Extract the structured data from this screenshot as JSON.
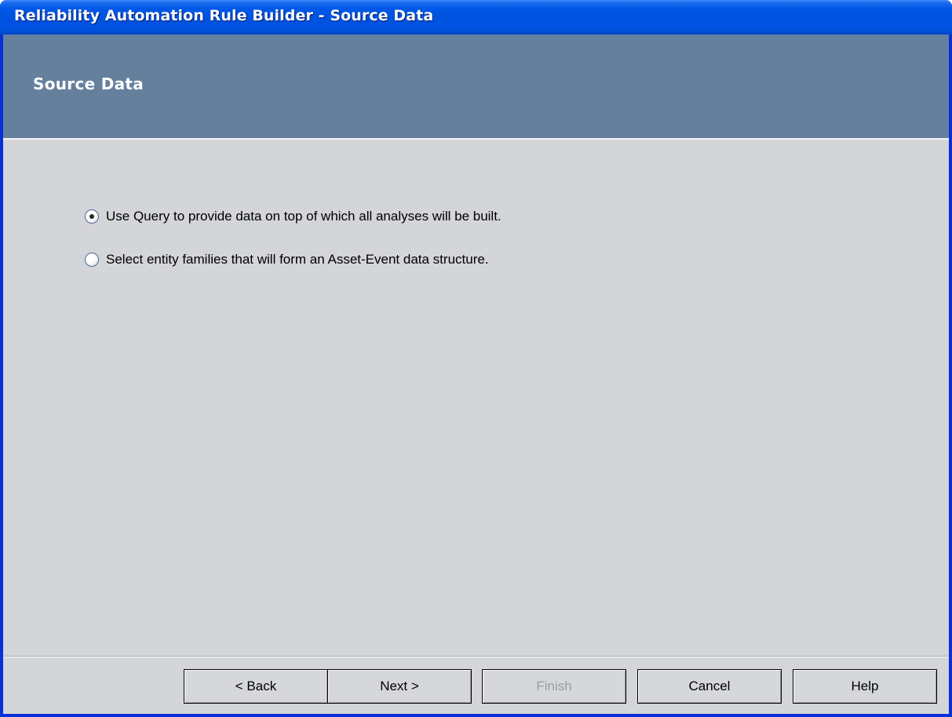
{
  "window": {
    "title": "Reliability Automation Rule Builder - Source Data"
  },
  "header": {
    "title": "Source Data"
  },
  "options": [
    {
      "label": "Use Query to provide data on top of which all analyses will be built.",
      "selected": true
    },
    {
      "label": "Select entity families that will form an Asset-Event data structure.",
      "selected": false
    }
  ],
  "buttons": {
    "back": "< Back",
    "next": "Next >",
    "finish": "Finish",
    "cancel": "Cancel",
    "help": "Help"
  },
  "colors": {
    "titlebar": "#0053e1",
    "header_band": "#65809d",
    "client_bg": "#d3d5d8"
  }
}
